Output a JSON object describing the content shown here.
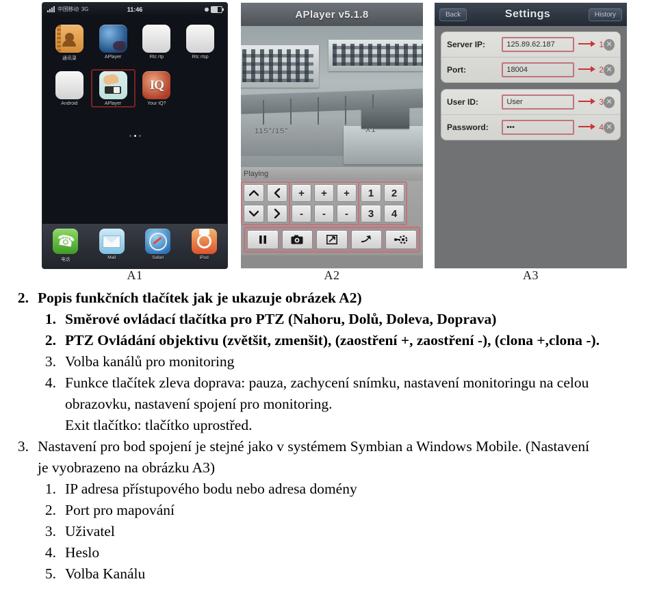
{
  "figures": {
    "a1": {
      "caption": "A1",
      "statusbar": {
        "carrier": "中国移动",
        "network": "3G",
        "time": "11:46"
      },
      "apps": [
        {
          "label": "通讯录",
          "icon": "contacts-icon"
        },
        {
          "label": "APlayer",
          "icon": "globe-icon"
        },
        {
          "label": "Rtc rtp",
          "icon": "blank-icon"
        },
        {
          "label": "Rtc rtsp",
          "icon": "blank-icon"
        },
        {
          "label": "Android",
          "icon": "blank-icon"
        },
        {
          "label": "APlayer",
          "icon": "aplayer-icon",
          "selected": true
        },
        {
          "label": "Your IQ?",
          "icon": "iq-icon"
        }
      ],
      "dock": [
        {
          "label": "电话",
          "icon": "phone-icon"
        },
        {
          "label": "Mail",
          "icon": "mail-icon"
        },
        {
          "label": "Safari",
          "icon": "safari-icon"
        },
        {
          "label": "iPod",
          "icon": "ipod-icon"
        }
      ]
    },
    "a2": {
      "caption": "A2",
      "title": "APlayer v5.1.8",
      "osd_left": "115°/15°",
      "osd_right": "X1",
      "status": "Playing",
      "ptz_buttons": [
        "up",
        "left",
        "down",
        "right"
      ],
      "lens_buttons": [
        "+",
        "+",
        "+",
        "-",
        "-",
        "-"
      ],
      "channel_buttons": [
        "1",
        "2",
        "3",
        "4"
      ],
      "bottom_buttons": [
        "pause-icon",
        "snapshot-icon",
        "fullscreen-icon",
        "exit-icon",
        "settings-icon"
      ],
      "annotation_numbers": [
        "1",
        "2",
        "3",
        "4"
      ]
    },
    "a3": {
      "caption": "A3",
      "nav": {
        "back": "Back",
        "title": "Settings",
        "history": "History"
      },
      "rows": [
        {
          "label": "Server IP:",
          "value": "125.89.62.187",
          "marker": "1"
        },
        {
          "label": "Port:",
          "value": "18004",
          "marker": "2"
        },
        {
          "label": "User ID:",
          "value": "User",
          "marker": "3"
        },
        {
          "label": "Password:",
          "value": "•••",
          "marker": "4"
        }
      ]
    }
  },
  "document": {
    "section2": {
      "num": "2.",
      "text": "Popis funkčních tlačítek jak je ukazuje obrázek A2)",
      "items": [
        {
          "num": "1.",
          "text": "Směrové ovládací tlačítka pro PTZ (Nahoru, Dolů, Doleva, Doprava)"
        },
        {
          "num": "2.",
          "text": "PTZ Ovládání objektivu (zvětšit, zmenšit), (zaostření +, zaostření -), (clona +,clona -)."
        },
        {
          "num": "3.",
          "text": "Volba kanálů pro monitoring"
        },
        {
          "num": "4.",
          "text": "Funkce tlačítek zleva doprava: pauza, zachycení snímku, nastavení monitoringu na celou"
        }
      ],
      "continuation1": "obrazovku, nastavení spojení pro monitoring.",
      "continuation2": "Exit tlačítko: tlačítko uprostřed."
    },
    "section3": {
      "num": "3.",
      "text": "Nastavení pro bod spojení je stejné jako v systémem Symbian a Windows Mobile. (Nastavení",
      "continuation": "je vyobrazeno na obrázku A3)",
      "items": [
        {
          "num": "1.",
          "text": "IP adresa přístupového bodu nebo adresa domény"
        },
        {
          "num": "2.",
          "text": "Port pro mapování"
        },
        {
          "num": "3.",
          "text": "Uživatel"
        },
        {
          "num": "4.",
          "text": "Heslo"
        },
        {
          "num": "5.",
          "text": "Volba Kanálu"
        }
      ]
    }
  }
}
